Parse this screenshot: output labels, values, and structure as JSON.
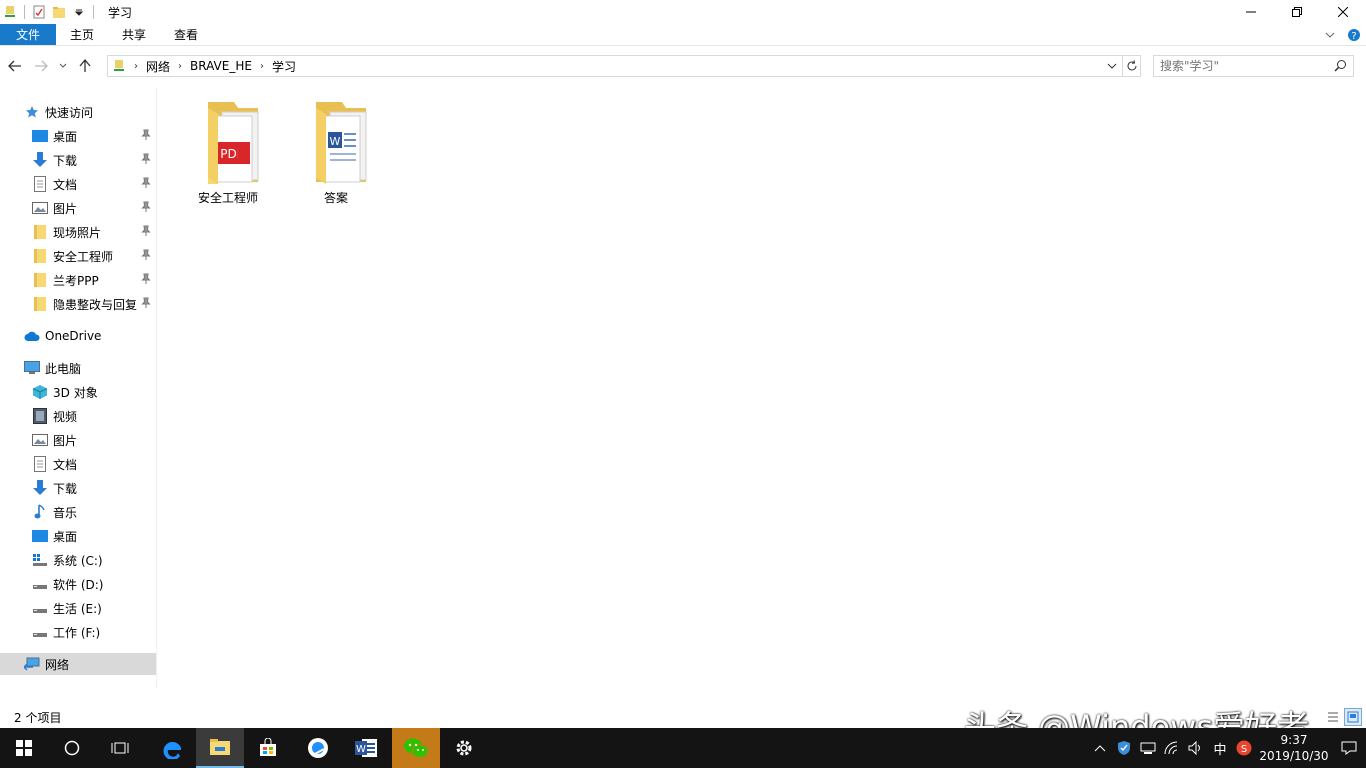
{
  "window": {
    "title": "学习"
  },
  "ribbon": {
    "tabs": [
      {
        "label": "文件"
      },
      {
        "label": "主页"
      },
      {
        "label": "共享"
      },
      {
        "label": "查看"
      }
    ]
  },
  "address": {
    "crumbs": [
      "网络",
      "BRAVE_HE",
      "学习"
    ]
  },
  "search": {
    "placeholder": "搜索\"学习\""
  },
  "sidebar": {
    "quick_access": "快速访问",
    "quick_items": [
      {
        "label": "桌面",
        "icon": "desktop-icon"
      },
      {
        "label": "下载",
        "icon": "download-icon"
      },
      {
        "label": "文档",
        "icon": "document-icon"
      },
      {
        "label": "图片",
        "icon": "picture-icon"
      },
      {
        "label": "现场照片",
        "icon": "folder-icon"
      },
      {
        "label": "安全工程师",
        "icon": "folder-icon"
      },
      {
        "label": "兰考PPP",
        "icon": "folder-icon"
      },
      {
        "label": "隐患整改与回复",
        "icon": "folder-icon"
      }
    ],
    "onedrive": "OneDrive",
    "this_pc": "此电脑",
    "pc_items": [
      {
        "label": "3D 对象",
        "icon": "3d-objects-icon"
      },
      {
        "label": "视频",
        "icon": "video-icon"
      },
      {
        "label": "图片",
        "icon": "picture-icon"
      },
      {
        "label": "文档",
        "icon": "document-icon"
      },
      {
        "label": "下载",
        "icon": "download-icon"
      },
      {
        "label": "音乐",
        "icon": "music-icon"
      },
      {
        "label": "桌面",
        "icon": "desktop-icon"
      },
      {
        "label": "系统 (C:)",
        "icon": "system-drive-icon"
      },
      {
        "label": "软件 (D:)",
        "icon": "drive-icon"
      },
      {
        "label": "生活 (E:)",
        "icon": "drive-icon"
      },
      {
        "label": "工作 (F:)",
        "icon": "drive-icon"
      }
    ],
    "network": "网络"
  },
  "content": {
    "folders": [
      {
        "label": "安全工程师",
        "preview": "pdf"
      },
      {
        "label": "答案",
        "preview": "word"
      }
    ]
  },
  "status": {
    "count": "2 个项目"
  },
  "taskbar": {
    "tray_lang": "中",
    "time": "9:37",
    "date": "2019/10/30"
  },
  "watermark": "头条 @Windows爱好者",
  "colors": {
    "accent": "#1979ca",
    "folder": "#f8d775",
    "taskbar": "#141414"
  }
}
